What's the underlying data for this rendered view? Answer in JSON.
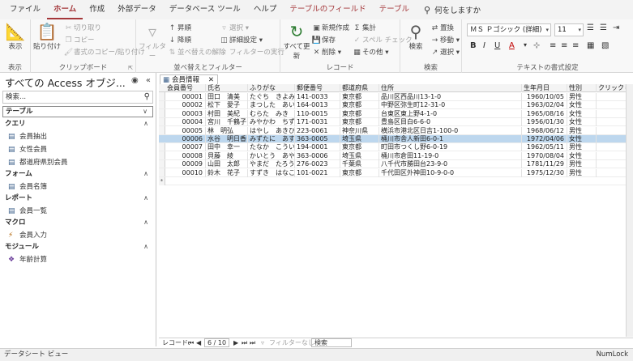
{
  "menu": {
    "tabs": [
      "ファイル",
      "ホーム",
      "作成",
      "外部データ",
      "データベース ツール",
      "ヘルプ",
      "テーブルのフィールド",
      "テーブル"
    ],
    "active_index": 1,
    "search_label": "何をしますか"
  },
  "ribbon": {
    "view": {
      "label": "表示",
      "group": "表示"
    },
    "clipboard": {
      "paste": "貼り付け",
      "cut": "切り取り",
      "copy": "コピー",
      "format_painter": "書式のコピー/貼り付け",
      "group": "クリップボード"
    },
    "sort_filter": {
      "filter": "フィルター",
      "asc": "昇順",
      "desc": "降順",
      "clear_sort": "並べ替えの解除",
      "selection": "選択",
      "advanced": "詳細設定",
      "toggle_filter": "フィルターの実行",
      "group": "並べ替えとフィルター"
    },
    "records": {
      "refresh": "すべて更新",
      "new": "新規作成",
      "save": "保存",
      "delete": "削除",
      "totals": "集計",
      "spelling": "スペル チェック",
      "more": "その他",
      "group": "レコード"
    },
    "find": {
      "find": "検索",
      "replace": "置換",
      "goto": "移動",
      "select": "選択",
      "group": "検索"
    },
    "text_format": {
      "font": "ＭＳ Ｐゴシック (詳細)",
      "size": "11",
      "group": "テキストの書式設定"
    }
  },
  "nav": {
    "title": "すべての Access オブジ...",
    "search_placeholder": "検索...",
    "sections": [
      {
        "label": "テーブル",
        "items": []
      },
      {
        "label": "クエリ",
        "items": [
          "会員抽出",
          "女性会員",
          "都道府県別会員"
        ]
      },
      {
        "label": "フォーム",
        "items": [
          "会員名簿"
        ]
      },
      {
        "label": "レポート",
        "items": [
          "会員一覧"
        ]
      },
      {
        "label": "マクロ",
        "items": [
          "会員入力"
        ]
      },
      {
        "label": "モジュール",
        "items": [
          "年齢計算"
        ]
      }
    ]
  },
  "document": {
    "tab_label": "会員情報",
    "columns": [
      "会員番号",
      "氏名",
      "ふりがな",
      "郵便番号",
      "都道府県",
      "住所",
      "生年月日",
      "性別",
      "クリックし"
    ],
    "rows": [
      [
        "00001",
        "田口　清美",
        "たぐち　きよみ",
        "141-0033",
        "東京都",
        "品川区西品川13-1-0",
        "1960/10/05",
        "男性"
      ],
      [
        "00002",
        "松下　愛子",
        "まつした　あいこ",
        "164-0013",
        "東京都",
        "中野区弥生町12-31-0",
        "1963/02/04",
        "女性"
      ],
      [
        "00003",
        "村田　美紀",
        "むらた　みき",
        "110-0015",
        "東京都",
        "台東区東上野4-1-0",
        "1965/08/16",
        "女性"
      ],
      [
        "00004",
        "宮川　千鶴子",
        "みやかわ　ちずこ",
        "171-0031",
        "東京都",
        "豊島区目白6-6-0",
        "1956/01/30",
        "女性"
      ],
      [
        "00005",
        "林　明弘",
        "はやし　あきひろ",
        "223-0061",
        "神奈川県",
        "横浜市港北区日吉1-100-0",
        "1968/06/12",
        "男性"
      ],
      [
        "00006",
        "水谷　明日香",
        "みずたに　あすか",
        "363-0005",
        "埼玉県",
        "桶川市舎人新田6-0-1",
        "1972/04/06",
        "女性"
      ],
      [
        "00007",
        "田中　幸一",
        "たなか　こういち",
        "194-0001",
        "東京都",
        "町田市つくし野6-0-19",
        "1962/05/11",
        "男性"
      ],
      [
        "00008",
        "貝藤　綾",
        "かいとう　あや",
        "363-0006",
        "埼玉県",
        "桶川市倉田11-19-0",
        "1970/08/04",
        "女性"
      ],
      [
        "00009",
        "山田　太郎",
        "やまだ　たろう",
        "276-0023",
        "千葉県",
        "八千代市勝田台23-9-0",
        "1781/11/29",
        "男性"
      ],
      [
        "00010",
        "鈴木　花子",
        "すずき　はなこ",
        "101-0021",
        "東京都",
        "千代田区外神田10-9-0-0",
        "1975/12/30",
        "男性"
      ]
    ],
    "selected_row": 5
  },
  "record_nav": {
    "label": "レコード:",
    "position": "6 / 10",
    "filter": "フィルターなし",
    "search": "検索"
  },
  "status": {
    "left": "データシート ビュー",
    "right": "NumLock"
  }
}
